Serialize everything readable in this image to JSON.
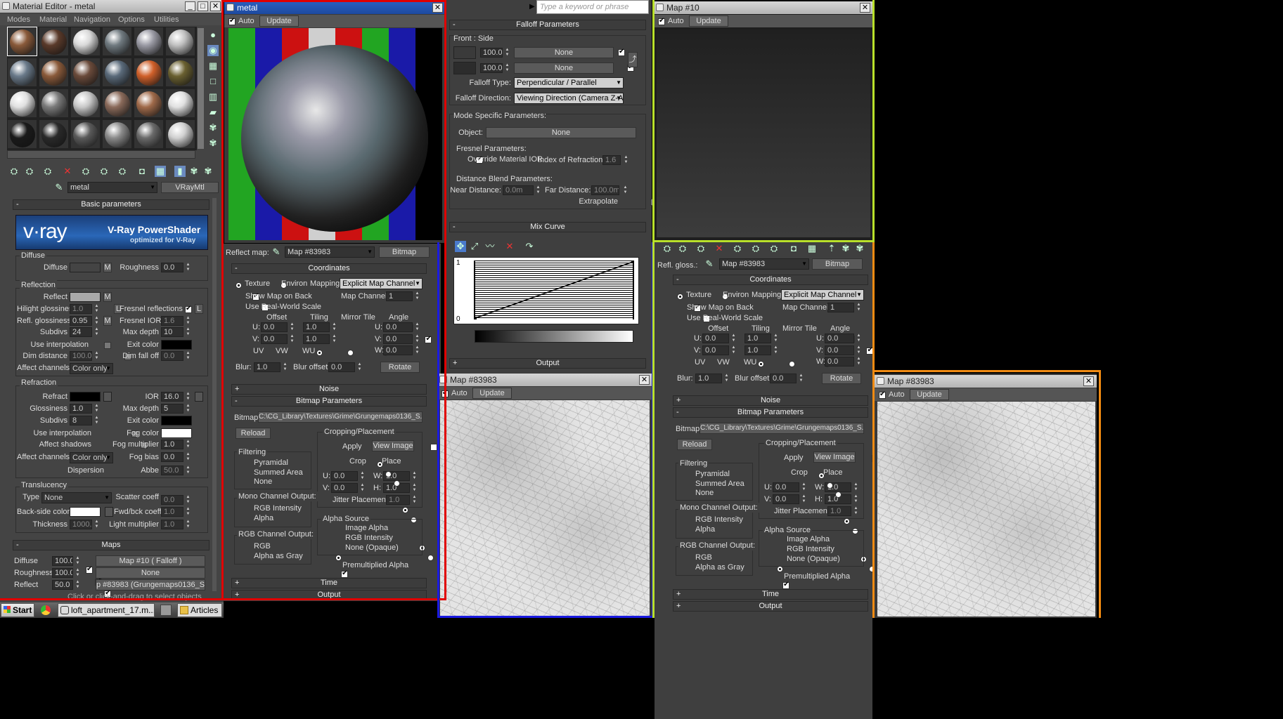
{
  "material_editor": {
    "title": "Material Editor - metal",
    "menu": [
      "Modes",
      "Material",
      "Navigation",
      "Options",
      "Utilities"
    ],
    "material_name": "metal",
    "material_type": "VRayMtl",
    "rollout_basic": "Basic parameters",
    "vray_logo": "v·ray",
    "vray_title": "V-Ray PowerShader",
    "vray_sub": "optimized for V-Ray",
    "diffuse": {
      "group": "Diffuse",
      "label": "Diffuse",
      "m": "M",
      "roughness_label": "Roughness",
      "roughness": "0.0"
    },
    "reflection": {
      "group": "Reflection",
      "reflect": "Reflect",
      "m": "M",
      "hilight_label": "Hilight glossiness",
      "hilight": "1.0",
      "l": "L",
      "fresnel_label": "Fresnel reflections",
      "refl_gloss_label": "Refl. glossiness",
      "refl_gloss": "0.95",
      "fresnel_ior_label": "Fresnel IOR",
      "fresnel_ior": "1.6",
      "subdivs_label": "Subdivs",
      "subdivs": "24",
      "max_depth_label": "Max depth",
      "max_depth": "10",
      "use_interp": "Use interpolation",
      "exit_color": "Exit color",
      "dim_distance_label": "Dim distance",
      "dim_distance": "100.0m",
      "dim_falloff_label": "Dim fall off",
      "dim_falloff": "0.0",
      "affect_channels_label": "Affect channels",
      "affect_channels": "Color only"
    },
    "refraction": {
      "group": "Refraction",
      "refract": "Refract",
      "ior_label": "IOR",
      "ior": "16.0",
      "glossiness_label": "Glossiness",
      "glossiness": "1.0",
      "max_depth_label": "Max depth",
      "max_depth": "5",
      "subdivs_label": "Subdivs",
      "subdivs": "8",
      "exit_color": "Exit color",
      "use_interp": "Use interpolation",
      "fog_color": "Fog color",
      "affect_shadows": "Affect shadows",
      "fog_mult_label": "Fog multiplier",
      "fog_mult": "1.0",
      "affect_channels_label": "Affect channels",
      "affect_channels": "Color only",
      "fog_bias_label": "Fog bias",
      "fog_bias": "0.0",
      "dispersion": "Dispersion",
      "abbe_label": "Abbe",
      "abbe": "50.0"
    },
    "translucency": {
      "group": "Translucency",
      "type_label": "Type",
      "type": "None",
      "scatter_label": "Scatter coeff",
      "scatter": "0.0",
      "back_label": "Back-side color",
      "fwd_label": "Fwd/bck coeff",
      "fwd": "1.0",
      "thickness_label": "Thickness",
      "thickness": "1000.0",
      "light_mult_label": "Light multiplier",
      "light_mult": "1.0"
    },
    "maps_header": "Maps",
    "maps": [
      {
        "name": "Diffuse",
        "amount": "100.0",
        "map": "Map #10  ( Falloff )"
      },
      {
        "name": "Roughness",
        "amount": "100.0",
        "map": "None"
      },
      {
        "name": "Reflect",
        "amount": "50.0",
        "map": "p #83983 (Grungemaps0136_S.jpg)"
      }
    ],
    "status": "Click or click-and-drag to select objects"
  },
  "metal_view": {
    "title": "metal",
    "auto": "Auto",
    "update": "Update"
  },
  "search": {
    "placeholder": "Type a keyword or phrase"
  },
  "falloff": {
    "header": "Falloff Parameters",
    "front_side": "Front : Side",
    "rows": [
      {
        "val": "100.0",
        "map": "None"
      },
      {
        "val": "100.0",
        "map": "None"
      }
    ],
    "type_label": "Falloff Type:",
    "type": "Perpendicular / Parallel",
    "dir_label": "Falloff Direction:",
    "dir": "Viewing Direction (Camera Z-Axis)",
    "mode_header": "Mode Specific Parameters:",
    "object_label": "Object:",
    "object": "None",
    "fresnel_header": "Fresnel Parameters:",
    "override_ior": "Override Material IOR",
    "ior_label": "Index of Refraction",
    "ior": "1.6",
    "distance_header": "Distance Blend Parameters:",
    "near_label": "Near Distance:",
    "near": "0.0m",
    "far_label": "Far Distance:",
    "far": "100.0m",
    "extrapolate": "Extrapolate",
    "mix_curve": "Mix Curve",
    "curve_top": "1",
    "curve_bottom": "0",
    "output": "Output"
  },
  "reflect_map": {
    "label": "Reflect map:",
    "map": "Map #83983",
    "type": "Bitmap"
  },
  "refl_gloss_map": {
    "label": "Refl. gloss.:",
    "map": "Map #83983",
    "type": "Bitmap"
  },
  "coords": {
    "header": "Coordinates",
    "texture": "Texture",
    "environ": "Environ",
    "mapping_label": "Mapping:",
    "mapping": "Explicit Map Channel",
    "show_map": "Show Map on Back",
    "map_channel_label": "Map Channel:",
    "map_channel": "1",
    "real_world": "Use Real-World Scale",
    "offset": "Offset",
    "tiling": "Tiling",
    "mirror_tile": "Mirror Tile",
    "angle": "Angle",
    "u": "U:",
    "v": "V:",
    "w": "W:",
    "u_off": "0.0",
    "v_off": "0.0",
    "u_tile": "1.0",
    "v_tile": "1.0",
    "u_ang": "0.0",
    "v_ang": "0.0",
    "w_ang": "0.0",
    "uv": "UV",
    "vw": "VW",
    "wu": "WU",
    "blur_label": "Blur:",
    "blur": "1.0",
    "blur_off_label": "Blur offset:",
    "blur_off": "0.0",
    "rotate": "Rotate"
  },
  "bitmap": {
    "noise": "Noise",
    "header": "Bitmap Parameters",
    "bitmap_label": "Bitmap:",
    "path": "C:\\CG_Library\\Textures\\Grime\\Grungemaps0136_S.jpg",
    "reload": "Reload",
    "cropping": "Cropping/Placement",
    "apply": "Apply",
    "view_image": "View Image",
    "crop": "Crop",
    "place": "Place",
    "filtering": "Filtering",
    "pyramidal": "Pyramidal",
    "summed": "Summed Area",
    "none": "None",
    "u": "U:",
    "v": "V:",
    "w": "W:",
    "h": "H:",
    "u_val": "0.0",
    "v_val": "0.0",
    "w_val": "1.0",
    "h_val": "1.0",
    "jitter": "Jitter Placement:",
    "jitter_val": "1.0",
    "mono": "Mono Channel Output:",
    "rgb_int": "RGB Intensity",
    "alpha": "Alpha",
    "rgb_out": "RGB Channel Output:",
    "rgb": "RGB",
    "alpha_gray": "Alpha as Gray",
    "alpha_src": "Alpha Source",
    "image_alpha": "Image Alpha",
    "rgb_int2": "RGB Intensity",
    "none_opaque": "None (Opaque)",
    "premult": "Premultiplied Alpha",
    "time": "Time",
    "output": "Output"
  },
  "map10": {
    "title": "Map #10",
    "auto": "Auto",
    "update": "Update"
  },
  "map83983_a": {
    "title": "Map #83983",
    "auto": "Auto",
    "update": "Update"
  },
  "map83983_b": {
    "title": "Map #83983",
    "auto": "Auto",
    "update": "Update"
  },
  "taskbar": {
    "start": "Start",
    "item": "loft_apartment_17.m...",
    "articles": "Articles"
  }
}
